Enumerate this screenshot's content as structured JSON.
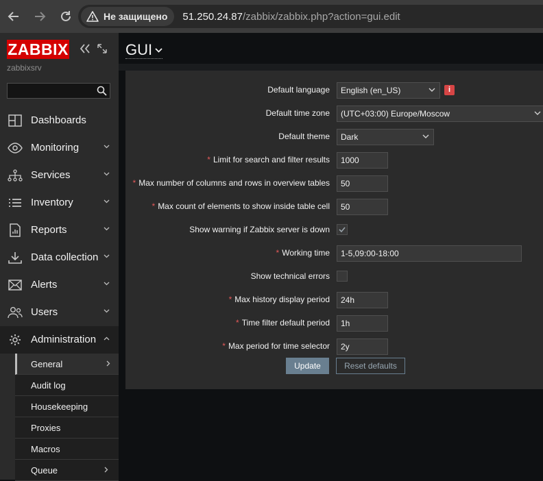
{
  "browser": {
    "security_label": "Не защищено",
    "url_host": "51.250.24.87",
    "url_path": "/zabbix/zabbix.php?action=gui.edit"
  },
  "sidebar": {
    "logo": "ZABBIX",
    "server_name": "zabbixsrv",
    "search_placeholder": "",
    "items": [
      {
        "label": "Dashboards",
        "icon": "dashboards-icon",
        "has_chevron": false
      },
      {
        "label": "Monitoring",
        "icon": "eye-icon",
        "has_chevron": true
      },
      {
        "label": "Services",
        "icon": "services-tree-icon",
        "has_chevron": true
      },
      {
        "label": "Inventory",
        "icon": "list-icon",
        "has_chevron": true
      },
      {
        "label": "Reports",
        "icon": "reports-icon",
        "has_chevron": true
      },
      {
        "label": "Data collection",
        "icon": "download-icon",
        "has_chevron": true
      },
      {
        "label": "Alerts",
        "icon": "envelope-icon",
        "has_chevron": true
      },
      {
        "label": "Users",
        "icon": "users-icon",
        "has_chevron": true
      },
      {
        "label": "Administration",
        "icon": "gear-icon",
        "has_chevron": true,
        "expanded": true
      }
    ],
    "submenu": [
      {
        "label": "General",
        "selected": true,
        "has_arrow": true
      },
      {
        "label": "Audit log",
        "selected": false,
        "has_arrow": false
      },
      {
        "label": "Housekeeping",
        "selected": false,
        "has_arrow": false
      },
      {
        "label": "Proxies",
        "selected": false,
        "has_arrow": false
      },
      {
        "label": "Macros",
        "selected": false,
        "has_arrow": false
      },
      {
        "label": "Queue",
        "selected": false,
        "has_arrow": true
      }
    ]
  },
  "page": {
    "title": "GUI"
  },
  "form": {
    "default_language": {
      "label": "Default language",
      "value": "English (en_US)"
    },
    "default_timezone": {
      "label": "Default time zone",
      "value": "(UTC+03:00) Europe/Moscow"
    },
    "default_theme": {
      "label": "Default theme",
      "value": "Dark"
    },
    "search_limit": {
      "label": "Limit for search and filter results",
      "value": "1000",
      "required": true
    },
    "max_overview": {
      "label": "Max number of columns and rows in overview tables",
      "value": "50",
      "required": true
    },
    "max_in_table": {
      "label": "Max count of elements to show inside table cell",
      "value": "50",
      "required": true
    },
    "server_check": {
      "label": "Show warning if Zabbix server is down",
      "checked": true
    },
    "work_period": {
      "label": "Working time",
      "value": "1-5,09:00-18:00",
      "required": true
    },
    "show_technical_errors": {
      "label": "Show technical errors",
      "checked": false
    },
    "history_period": {
      "label": "Max history display period",
      "value": "24h",
      "required": true
    },
    "period_default": {
      "label": "Time filter default period",
      "value": "1h",
      "required": true
    },
    "max_period": {
      "label": "Max period for time selector",
      "value": "2y",
      "required": true
    },
    "required_mark": "*",
    "info_mark": "i",
    "update_label": "Update",
    "reset_label": "Reset defaults"
  },
  "colors": {
    "accent": "#d40000",
    "button": "#697f90",
    "required": "#e45959"
  }
}
